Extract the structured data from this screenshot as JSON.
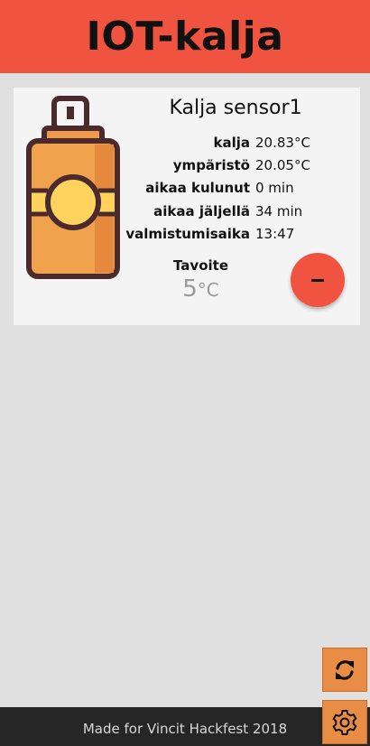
{
  "header": {
    "title": "IOT-kalja"
  },
  "sensor": {
    "name": "Kalja sensor1",
    "readings": [
      {
        "label": "kalja",
        "value": "20.83°C"
      },
      {
        "label": "ympäristö",
        "value": "20.05°C"
      },
      {
        "label": "aikaa kulunut",
        "value": "0 min"
      },
      {
        "label": "aikaa jäljellä",
        "value": "34 min"
      },
      {
        "label": "valmistumisaika",
        "value": "13:47"
      }
    ],
    "target": {
      "label": "Tavoite",
      "value": "5",
      "unit": "°C"
    },
    "decrease_icon": "minus-icon",
    "image_icon": "beer-can-icon"
  },
  "actions": {
    "refresh_icon": "refresh-icon",
    "settings_icon": "gear-icon"
  },
  "footer": {
    "text": "Made for Vincit Hackfest 2018"
  },
  "colors": {
    "header": "#f05340",
    "accent_button": "#f05340",
    "fab": "#e98c45",
    "footer": "#262626",
    "background": "#e0e0e0",
    "card": "#f4f4f4"
  }
}
